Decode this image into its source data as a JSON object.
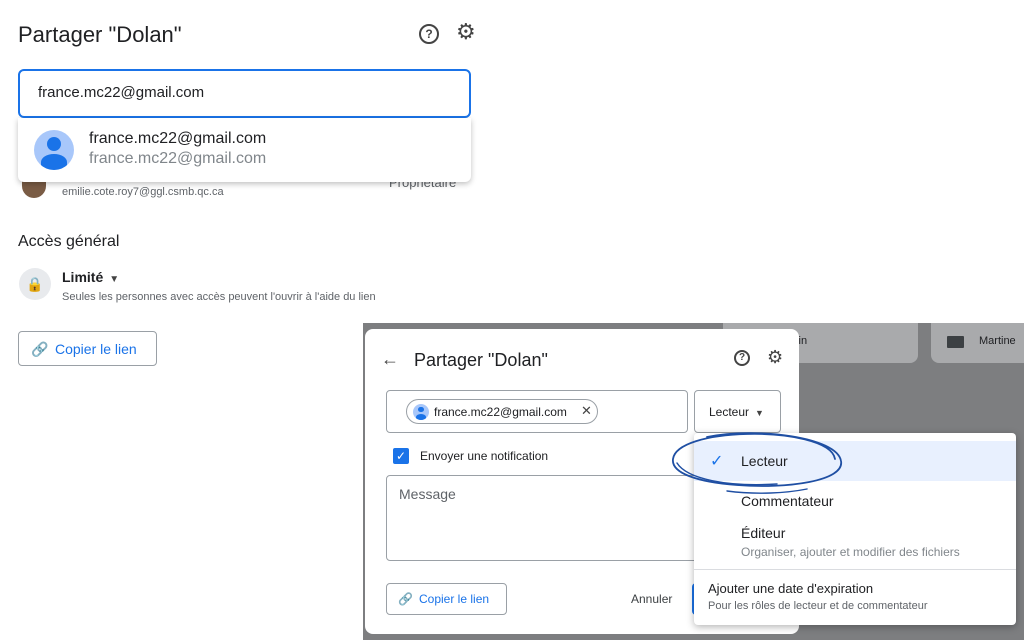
{
  "share_panel": {
    "title": "Partager \"Dolan\"",
    "search_value": "france.mc22@gmail.com",
    "suggestion": {
      "name": "france.mc22@gmail.com",
      "email": "france.mc22@gmail.com"
    },
    "owner": {
      "email": "emilie.cote.roy7@ggl.csmb.qc.ca",
      "role": "Propriétaire"
    },
    "general_access": {
      "title": "Accès général",
      "level": "Limité",
      "description": "Seules les personnes avec accès peuvent l'ouvrir à l'aide du lien"
    },
    "copy_link_label": "Copier le lien"
  },
  "dialog": {
    "title": "Partager \"Dolan\"",
    "chip_email": "france.mc22@gmail.com",
    "role_label": "Lecteur",
    "notify_label": "Envoyer une notification",
    "message_placeholder": "Message",
    "copy_link_label": "Copier le lien",
    "cancel_label": "Annuler"
  },
  "background": {
    "folder_a": "vin",
    "folder_b": "Martine"
  },
  "role_menu": {
    "reader": "Lecteur",
    "commenter": "Commentateur",
    "editor": "Éditeur",
    "editor_desc": "Organiser, ajouter et modifier des fichiers",
    "expiration": "Ajouter une date d'expiration",
    "expiration_desc": "Pour les rôles de lecteur et de commentateur"
  },
  "colors": {
    "accent": "#1a73e8",
    "annotation": "#1f4fa3",
    "menu_selected": "#e8f0fe"
  }
}
